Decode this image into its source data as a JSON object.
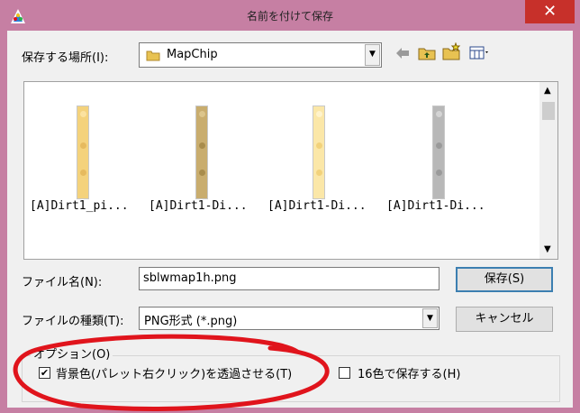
{
  "window": {
    "title": "名前を付けて保存",
    "close_glyph": "✕"
  },
  "location": {
    "label": "保存する場所(I):",
    "value": "MapChip"
  },
  "toolbar": {
    "back_icon": "back-arrow-icon",
    "up_icon": "up-folder-icon",
    "new_folder_icon": "new-folder-icon",
    "view_icon": "view-menu-icon"
  },
  "files": [
    {
      "name": "[A]Dirt1_pi...",
      "color": "#f4d27c"
    },
    {
      "name": "[A]Dirt1-Di...",
      "color": "#c9ad6e"
    },
    {
      "name": "[A]Dirt1-Di...",
      "color": "#fbe7a8"
    },
    {
      "name": "[A]Dirt1-Di...",
      "color": "#b8b8b8"
    }
  ],
  "filename": {
    "label": "ファイル名(N):",
    "value": "sblwmap1h.png"
  },
  "filetype": {
    "label": "ファイルの種類(T):",
    "value": "PNG形式 (*.png)"
  },
  "buttons": {
    "save": "保存(S)",
    "cancel": "キャンセル"
  },
  "options": {
    "group_label": "オプション(O)",
    "transparent_label": "背景色(パレット右クリック)を透過させる(T)",
    "transparent_checked": true,
    "sixteen_label": "16色で保存する(H)",
    "sixteen_checked": false
  },
  "colors": {
    "frame": "#c67fa3",
    "close": "#c7302a",
    "annotation": "#e0141c"
  }
}
